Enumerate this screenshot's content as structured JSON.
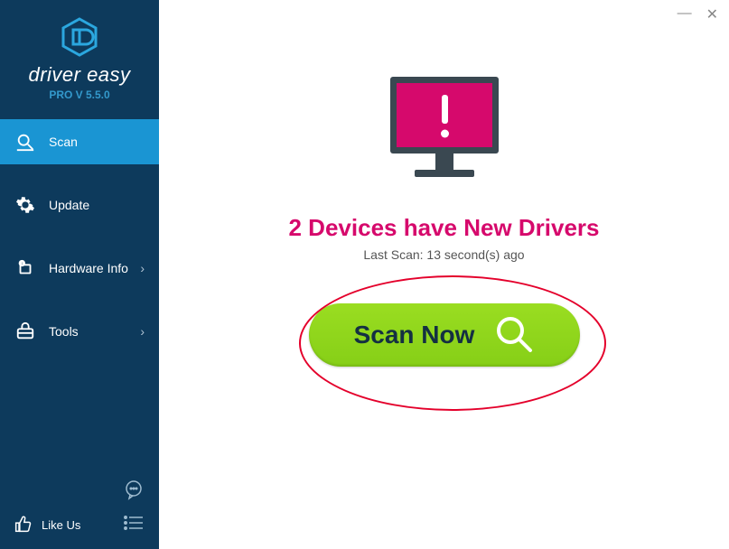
{
  "brand": {
    "name": "driver easy",
    "version": "PRO V 5.5.0"
  },
  "sidebar": {
    "items": [
      {
        "label": "Scan",
        "chevron": false
      },
      {
        "label": "Update",
        "chevron": false
      },
      {
        "label": "Hardware Info",
        "chevron": true
      },
      {
        "label": "Tools",
        "chevron": true
      }
    ],
    "like": "Like Us"
  },
  "main": {
    "headline": "2 Devices have New Drivers",
    "last_scan": "Last Scan: 13 second(s) ago",
    "scan_button": "Scan Now"
  }
}
